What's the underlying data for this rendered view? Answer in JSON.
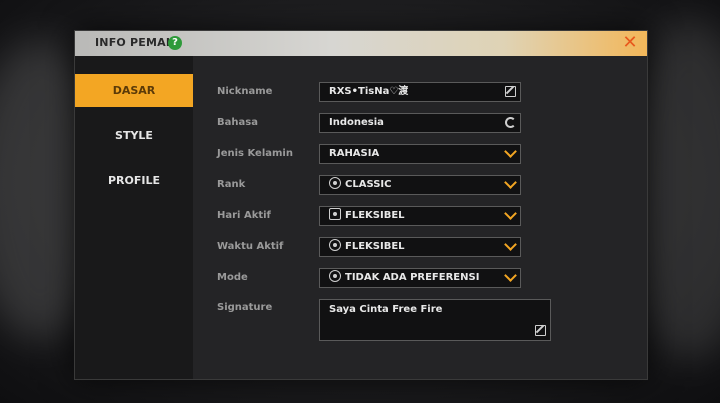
{
  "dialog": {
    "title": "INFO PEMAIN",
    "help_icon": "help-icon",
    "close_icon": "close-icon"
  },
  "sidebar": {
    "tabs": [
      {
        "label": "DASAR",
        "active": true
      },
      {
        "label": "STYLE",
        "active": false
      },
      {
        "label": "PROFILE",
        "active": false
      }
    ]
  },
  "form": {
    "nickname": {
      "label": "Nickname",
      "value": "RXS•TisNa♡渡"
    },
    "bahasa": {
      "label": "Bahasa",
      "value": "Indonesia"
    },
    "jenis_kelamin": {
      "label": "Jenis Kelamin",
      "value": "RAHASIA"
    },
    "rank": {
      "label": "Rank",
      "value": "CLASSIC"
    },
    "hari_aktif": {
      "label": "Hari Aktif",
      "value": "FLEKSIBEL"
    },
    "waktu_aktif": {
      "label": "Waktu Aktif",
      "value": "FLEKSIBEL"
    },
    "mode": {
      "label": "Mode",
      "value": "TIDAK ADA PREFERENSI"
    },
    "signature": {
      "label": "Signature",
      "value": "Saya Cinta Free Fire"
    }
  },
  "colors": {
    "accent": "#f3a623",
    "close": "#e8581c",
    "help": "#2e9a3a"
  }
}
